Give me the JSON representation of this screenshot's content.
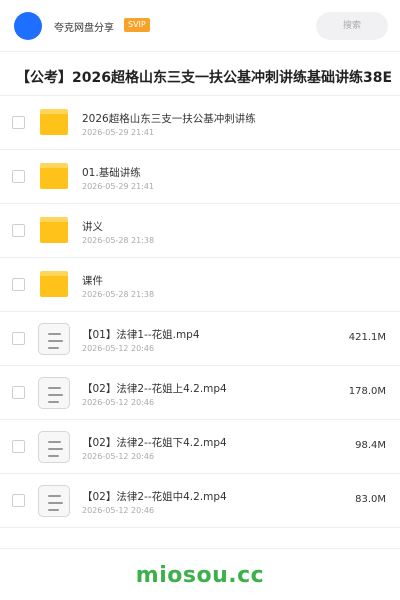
{
  "header": {
    "site_name": "夸克网盘分享",
    "badge": "SVIP",
    "search_placeholder": "搜索"
  },
  "share": {
    "title": "【公考】2026超格山东三支一扶公基冲刺讲练基础讲练38E"
  },
  "items": [
    {
      "type": "folder",
      "name": "2026超格山东三支一扶公基冲刺讲练",
      "date": "2026-05-29 21:41",
      "size": ""
    },
    {
      "type": "folder",
      "name": "01.基础讲练",
      "date": "2026-05-29 21:41",
      "size": ""
    },
    {
      "type": "folder",
      "name": "讲义",
      "date": "2026-05-28 21:38",
      "size": ""
    },
    {
      "type": "folder",
      "name": "课件",
      "date": "2026-05-28 21:38",
      "size": ""
    },
    {
      "type": "file",
      "name": "【01】法律1--花姐.mp4",
      "date": "2026-05-12 20:46",
      "size": "421.1M"
    },
    {
      "type": "file",
      "name": "【02】法律2--花姐上4.2.mp4",
      "date": "2026-05-12 20:46",
      "size": "178.0M"
    },
    {
      "type": "file",
      "name": "【02】法律2--花姐下4.2.mp4",
      "date": "2026-05-12 20:46",
      "size": "98.4M"
    },
    {
      "type": "file",
      "name": "【02】法律2--花姐中4.2.mp4",
      "date": "2026-05-12 20:46",
      "size": "83.0M"
    }
  ],
  "footer": {
    "brand": "miosou.cc"
  },
  "colors": {
    "accent": "#1f6fff",
    "badge": "#f7a229",
    "folder": "#ffc21a",
    "brand": "#3cb04b"
  },
  "icons": {
    "folder": "folder-icon",
    "file": "video-file-icon"
  }
}
